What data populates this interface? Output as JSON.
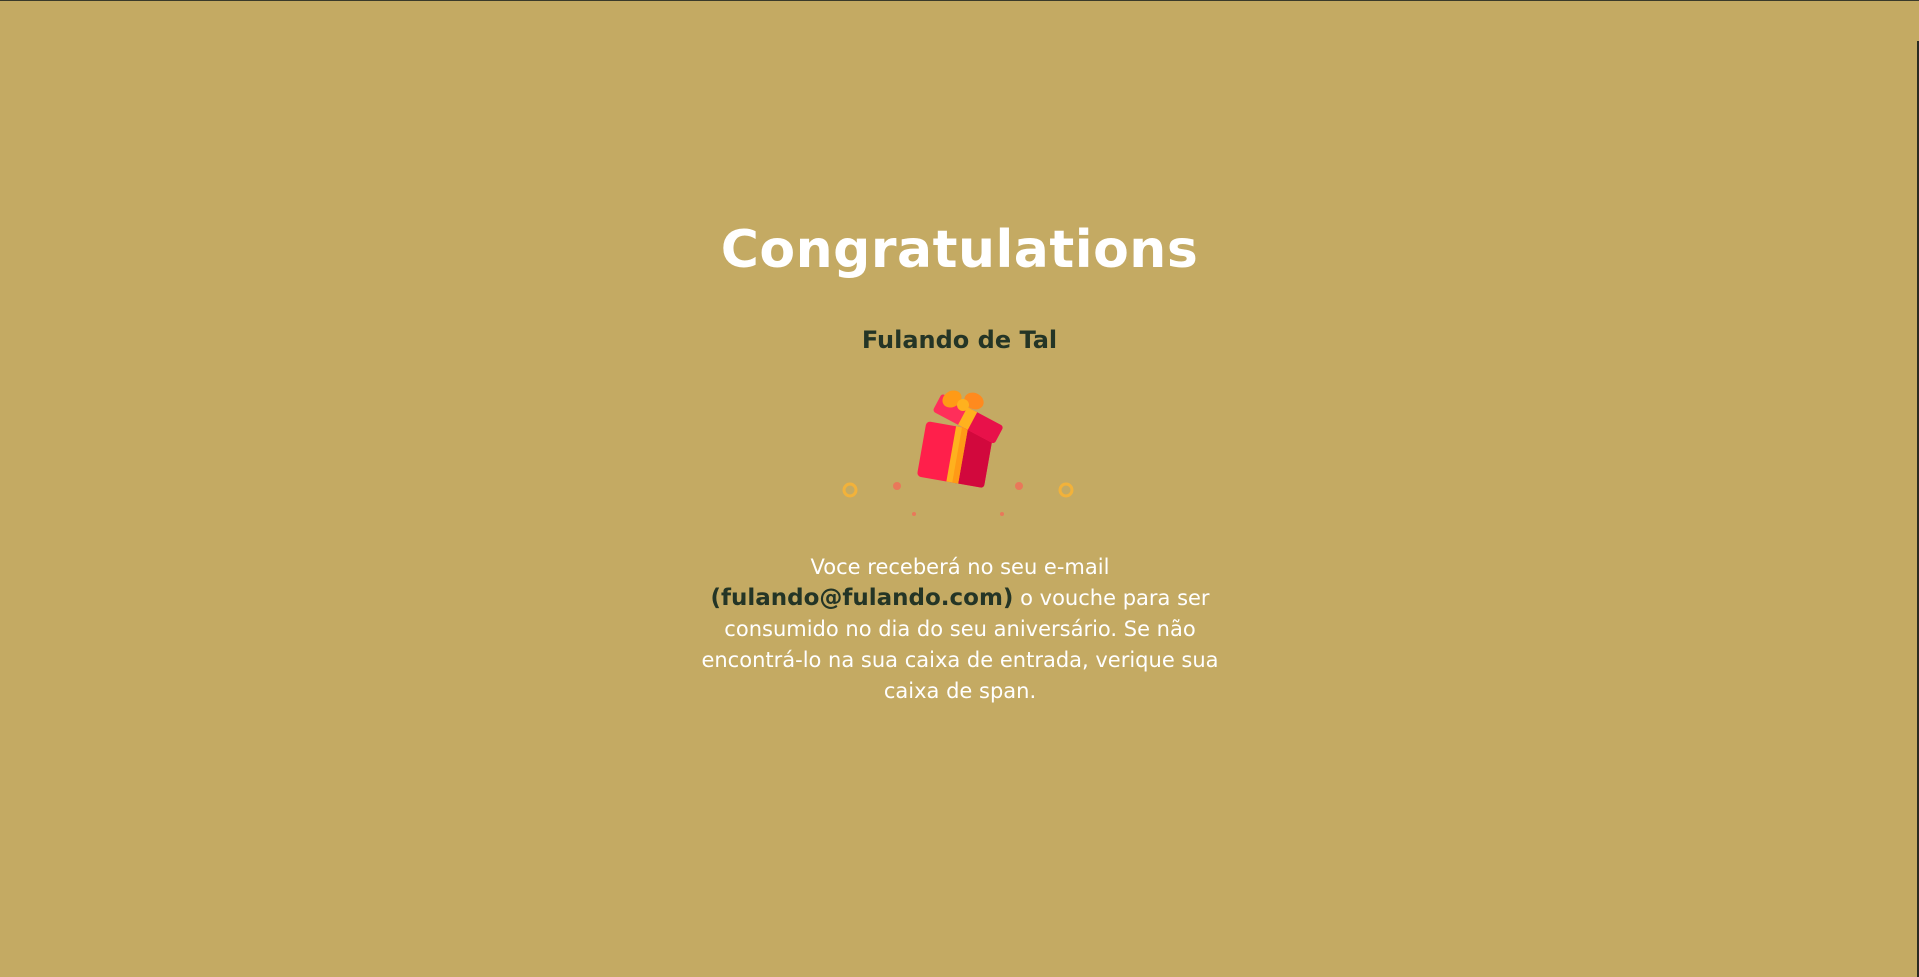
{
  "page": {
    "background": "#c4aa63",
    "title": "Congratulations",
    "name": "Fulando de Tal",
    "gift_icon": "gift-icon",
    "message": {
      "before": "Voce receberá no seu e-mail",
      "email": "(fulando@fulando.com)",
      "after": " o vouche para ser consumido no dia do seu aniversário. Se não encontrá-lo na sua caixa de entrada, verique sua caixa de span."
    }
  },
  "colors": {
    "title": "#ffffff",
    "name": "#243526",
    "email": "#243526",
    "gift_box": "#ff1f4b",
    "gift_ribbon": "#ffb11e",
    "gift_bow": "#ff8a1e"
  }
}
